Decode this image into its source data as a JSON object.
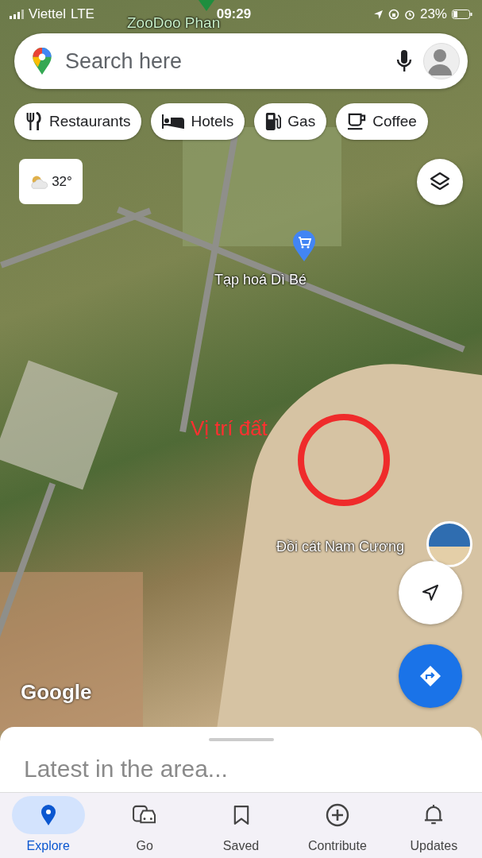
{
  "status_bar": {
    "carrier": "Viettel",
    "network": "LTE",
    "time": "09:29",
    "battery": "23%"
  },
  "search": {
    "placeholder": "Search here"
  },
  "chips": [
    {
      "label": "Restaurants",
      "kind": "restaurant"
    },
    {
      "label": "Hotels",
      "kind": "hotel"
    },
    {
      "label": "Gas",
      "kind": "gas"
    },
    {
      "label": "Coffee",
      "kind": "coffee"
    }
  ],
  "weather": {
    "temperature": "32°"
  },
  "map_labels": [
    {
      "text": "ZooDoo Phan",
      "kind": "place"
    },
    {
      "text": "Tạp hoá Dì Bé",
      "kind": "shop"
    },
    {
      "text": "Vị trí đất",
      "kind": "annotation"
    },
    {
      "text": "Đồi cát Nam Cương",
      "kind": "photo-place"
    }
  ],
  "attribution": "Google",
  "sheet": {
    "title": "Latest in the area..."
  },
  "nav": [
    {
      "label": "Explore",
      "kind": "explore",
      "selected": true
    },
    {
      "label": "Go",
      "kind": "go",
      "selected": false
    },
    {
      "label": "Saved",
      "kind": "saved",
      "selected": false
    },
    {
      "label": "Contribute",
      "kind": "contribute",
      "selected": false
    },
    {
      "label": "Updates",
      "kind": "updates",
      "selected": false
    }
  ]
}
